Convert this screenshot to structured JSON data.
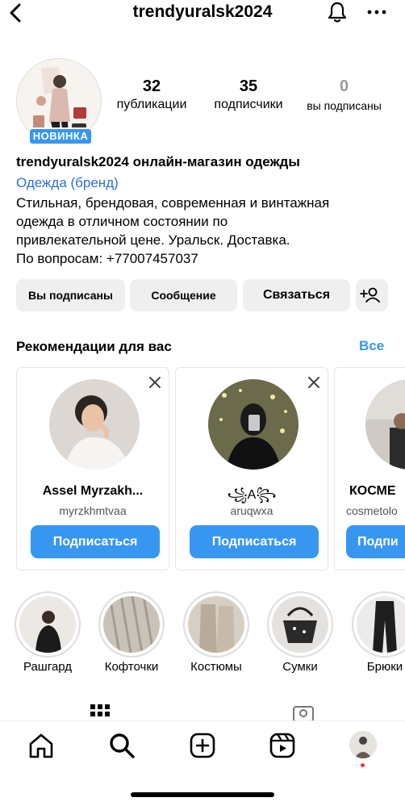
{
  "header": {
    "username": "trendyuralsk2024",
    "back_icon": "chevron-left-icon",
    "bell_icon": "bell-icon",
    "more_icon": "more-horizontal-icon"
  },
  "profile": {
    "badge": "НОВИНКА",
    "stats": [
      {
        "value": "32",
        "label": "публикации"
      },
      {
        "value": "35",
        "label": "подписчики"
      },
      {
        "value": "0",
        "label": "вы подписаны"
      }
    ],
    "name_line": "trendyuralsk2024 онлайн-магазин одежды",
    "category": "Одежда (бренд)",
    "bio_lines": [
      "Стильная, брендовая, современная и винтажная",
      "одежда в отличном состоянии по",
      "привлекательной цене. Уральск. Доставка.",
      "По вопросам: +77007457037"
    ]
  },
  "actions": {
    "following": "Вы подписаны",
    "message": "Сообщение",
    "contact": "Связаться",
    "add_user_icon": "add-user-icon"
  },
  "recommendations": {
    "title": "Рекомендации для вас",
    "see_all": "Все",
    "cards": [
      {
        "name": "Assel Myrzakh...",
        "handle": "myrzkhmtvaa",
        "button": "Подписаться"
      },
      {
        "name": "꧁A꧂",
        "handle": "aruqwxa",
        "button": "Подписаться"
      },
      {
        "name": "КОСМЕ",
        "handle": "cosmetolo",
        "button": "Подпи"
      }
    ]
  },
  "highlights": [
    {
      "label": "Рашгард"
    },
    {
      "label": "Кофточки"
    },
    {
      "label": "Костюмы"
    },
    {
      "label": "Сумки"
    },
    {
      "label": "Брюки"
    }
  ],
  "nav": {
    "items": [
      "home-icon",
      "search-icon",
      "create-icon",
      "reels-icon",
      "profile-avatar"
    ]
  },
  "colors": {
    "accent": "#3797f0",
    "link": "#2a6fd6",
    "button_gray": "#efefef",
    "notification_dot": "#ff3040"
  }
}
